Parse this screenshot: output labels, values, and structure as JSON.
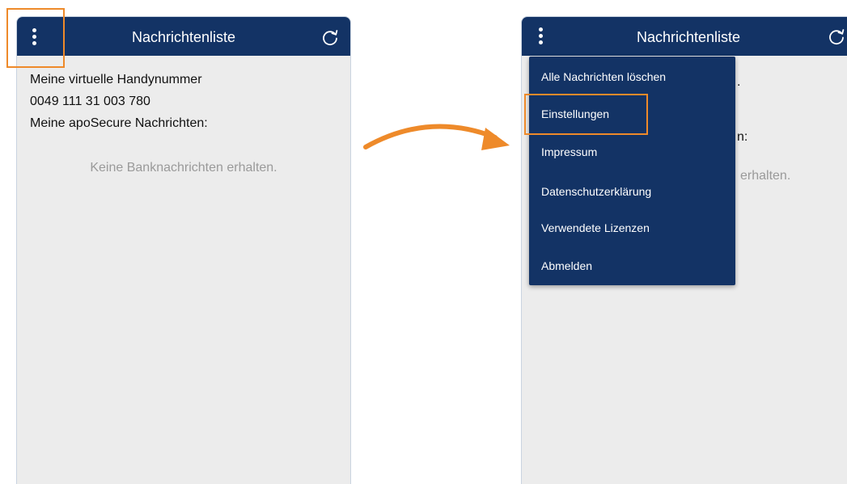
{
  "left_screen": {
    "header": {
      "title": "Nachrichtenliste",
      "menu_icon": "kebab-menu-icon",
      "refresh_icon": "refresh-icon"
    },
    "content": {
      "line1": "Meine virtuelle Handynummer",
      "line2": "0049 111 31 003 780",
      "line3": "Meine apoSecure Nachrichten:",
      "empty_message": "Keine Banknachrichten erhalten."
    }
  },
  "right_screen": {
    "header": {
      "title": "Nachrichtenliste",
      "menu_icon": "kebab-menu-icon",
      "refresh_icon": "refresh-icon"
    },
    "visible_behind": {
      "fragment_period": ".",
      "fragment_colon": "n:",
      "fragment_empty": "erhalten."
    },
    "menu": {
      "items": [
        "Alle Nachrichten löschen",
        "Einstellungen",
        "Impressum",
        "Datenschutzerklärung",
        "Verwendete Lizenzen",
        "Abmelden"
      ],
      "highlighted_item": "Einstellungen"
    }
  },
  "colors": {
    "header_bg": "#133365",
    "screen_bg": "#ececec",
    "highlight": "#ee8a2a",
    "arrow": "#ee8a2a"
  }
}
